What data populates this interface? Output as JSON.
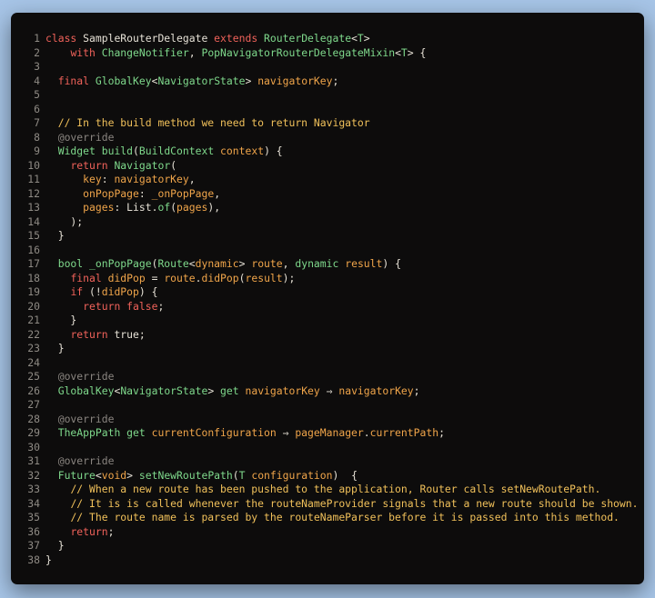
{
  "editor": {
    "lines": [
      {
        "n": "1",
        "tokens": [
          [
            "k",
            "class"
          ],
          [
            "n",
            " SampleRouterDelegate "
          ],
          [
            "k",
            "extends"
          ],
          [
            "n",
            " "
          ],
          [
            "t",
            "RouterDelegate"
          ],
          [
            "n",
            "<"
          ],
          [
            "t",
            "T"
          ],
          [
            "n",
            ">"
          ]
        ]
      },
      {
        "n": "2",
        "tokens": [
          [
            "n",
            "    "
          ],
          [
            "k",
            "with"
          ],
          [
            "n",
            " "
          ],
          [
            "t",
            "ChangeNotifier"
          ],
          [
            "n",
            ", "
          ],
          [
            "t",
            "PopNavigatorRouterDelegateMixin"
          ],
          [
            "n",
            "<"
          ],
          [
            "t",
            "T"
          ],
          [
            "n",
            "> {"
          ]
        ]
      },
      {
        "n": "3",
        "tokens": []
      },
      {
        "n": "4",
        "tokens": [
          [
            "n",
            "  "
          ],
          [
            "k",
            "final"
          ],
          [
            "n",
            " "
          ],
          [
            "t",
            "GlobalKey"
          ],
          [
            "n",
            "<"
          ],
          [
            "t",
            "NavigatorState"
          ],
          [
            "n",
            "> "
          ],
          [
            "o",
            "navigatorKey"
          ],
          [
            "n",
            ";"
          ]
        ]
      },
      {
        "n": "5",
        "tokens": []
      },
      {
        "n": "6",
        "tokens": []
      },
      {
        "n": "7",
        "tokens": [
          [
            "n",
            "  "
          ],
          [
            "c",
            "// In the build method we need to return Navigator"
          ]
        ]
      },
      {
        "n": "8",
        "tokens": [
          [
            "n",
            "  "
          ],
          [
            "d",
            "@override"
          ]
        ]
      },
      {
        "n": "9",
        "tokens": [
          [
            "n",
            "  "
          ],
          [
            "t",
            "Widget"
          ],
          [
            "n",
            " "
          ],
          [
            "t",
            "build"
          ],
          [
            "n",
            "("
          ],
          [
            "t",
            "BuildContext"
          ],
          [
            "n",
            " "
          ],
          [
            "o",
            "context"
          ],
          [
            "n",
            ") {"
          ]
        ]
      },
      {
        "n": "10",
        "tokens": [
          [
            "n",
            "    "
          ],
          [
            "k",
            "return"
          ],
          [
            "n",
            " "
          ],
          [
            "t",
            "Navigator"
          ],
          [
            "n",
            "("
          ]
        ]
      },
      {
        "n": "11",
        "tokens": [
          [
            "n",
            "      "
          ],
          [
            "o",
            "key"
          ],
          [
            "n",
            ": "
          ],
          [
            "o",
            "navigatorKey"
          ],
          [
            "n",
            ","
          ]
        ]
      },
      {
        "n": "12",
        "tokens": [
          [
            "n",
            "      "
          ],
          [
            "o",
            "onPopPage"
          ],
          [
            "n",
            ": "
          ],
          [
            "o",
            "_onPopPage"
          ],
          [
            "n",
            ","
          ]
        ]
      },
      {
        "n": "13",
        "tokens": [
          [
            "n",
            "      "
          ],
          [
            "o",
            "pages"
          ],
          [
            "n",
            ": "
          ],
          [
            "n",
            "List."
          ],
          [
            "t",
            "of"
          ],
          [
            "n",
            "("
          ],
          [
            "o",
            "pages"
          ],
          [
            "n",
            "),"
          ]
        ]
      },
      {
        "n": "14",
        "tokens": [
          [
            "n",
            "    );"
          ]
        ]
      },
      {
        "n": "15",
        "tokens": [
          [
            "n",
            "  }"
          ]
        ]
      },
      {
        "n": "16",
        "tokens": []
      },
      {
        "n": "17",
        "tokens": [
          [
            "n",
            "  "
          ],
          [
            "t",
            "bool"
          ],
          [
            "n",
            " "
          ],
          [
            "t",
            "_onPopPage"
          ],
          [
            "n",
            "("
          ],
          [
            "t",
            "Route"
          ],
          [
            "n",
            "<"
          ],
          [
            "o",
            "dynamic"
          ],
          [
            "n",
            "> "
          ],
          [
            "o",
            "route"
          ],
          [
            "n",
            ", "
          ],
          [
            "t",
            "dynamic"
          ],
          [
            "n",
            " "
          ],
          [
            "o",
            "result"
          ],
          [
            "n",
            ") {"
          ]
        ]
      },
      {
        "n": "18",
        "tokens": [
          [
            "n",
            "    "
          ],
          [
            "k",
            "final"
          ],
          [
            "n",
            " "
          ],
          [
            "o",
            "didPop"
          ],
          [
            "n",
            " = "
          ],
          [
            "o",
            "route"
          ],
          [
            "n",
            "."
          ],
          [
            "o",
            "didPop"
          ],
          [
            "n",
            "("
          ],
          [
            "o",
            "result"
          ],
          [
            "n",
            ");"
          ]
        ]
      },
      {
        "n": "19",
        "tokens": [
          [
            "n",
            "    "
          ],
          [
            "k",
            "if"
          ],
          [
            "n",
            " (!"
          ],
          [
            "o",
            "didPop"
          ],
          [
            "n",
            ") {"
          ]
        ]
      },
      {
        "n": "20",
        "tokens": [
          [
            "n",
            "      "
          ],
          [
            "k",
            "return"
          ],
          [
            "n",
            " "
          ],
          [
            "k",
            "false"
          ],
          [
            "n",
            ";"
          ]
        ]
      },
      {
        "n": "21",
        "tokens": [
          [
            "n",
            "    }"
          ]
        ]
      },
      {
        "n": "22",
        "tokens": [
          [
            "n",
            "    "
          ],
          [
            "k",
            "return"
          ],
          [
            "n",
            " "
          ],
          [
            "n",
            "true;"
          ]
        ]
      },
      {
        "n": "23",
        "tokens": [
          [
            "n",
            "  }"
          ]
        ]
      },
      {
        "n": "24",
        "tokens": []
      },
      {
        "n": "25",
        "tokens": [
          [
            "n",
            "  "
          ],
          [
            "d",
            "@override"
          ]
        ]
      },
      {
        "n": "26",
        "tokens": [
          [
            "n",
            "  "
          ],
          [
            "t",
            "GlobalKey"
          ],
          [
            "n",
            "<"
          ],
          [
            "t",
            "NavigatorState"
          ],
          [
            "n",
            "> "
          ],
          [
            "t",
            "get"
          ],
          [
            "n",
            " "
          ],
          [
            "o",
            "navigatorKey"
          ],
          [
            "n",
            " ⇒ "
          ],
          [
            "o",
            "navigatorKey"
          ],
          [
            "n",
            ";"
          ]
        ]
      },
      {
        "n": "27",
        "tokens": []
      },
      {
        "n": "28",
        "tokens": [
          [
            "n",
            "  "
          ],
          [
            "d",
            "@override"
          ]
        ]
      },
      {
        "n": "29",
        "tokens": [
          [
            "n",
            "  "
          ],
          [
            "t",
            "TheAppPath"
          ],
          [
            "n",
            " "
          ],
          [
            "t",
            "get"
          ],
          [
            "n",
            " "
          ],
          [
            "o",
            "currentConfiguration"
          ],
          [
            "n",
            " ⇒ "
          ],
          [
            "o",
            "pageManager"
          ],
          [
            "n",
            "."
          ],
          [
            "o",
            "currentPath"
          ],
          [
            "n",
            ";"
          ]
        ]
      },
      {
        "n": "30",
        "tokens": []
      },
      {
        "n": "31",
        "tokens": [
          [
            "n",
            "  "
          ],
          [
            "d",
            "@override"
          ]
        ]
      },
      {
        "n": "32",
        "tokens": [
          [
            "n",
            "  "
          ],
          [
            "t",
            "Future"
          ],
          [
            "n",
            "<"
          ],
          [
            "o",
            "void"
          ],
          [
            "n",
            "> "
          ],
          [
            "t",
            "setNewRoutePath"
          ],
          [
            "n",
            "("
          ],
          [
            "t",
            "T"
          ],
          [
            "n",
            " "
          ],
          [
            "o",
            "configuration"
          ],
          [
            "n",
            ")  {"
          ]
        ]
      },
      {
        "n": "33",
        "tokens": [
          [
            "n",
            "    "
          ],
          [
            "c",
            "// When a new route has been pushed to the application, Router calls setNewRoutePath."
          ]
        ]
      },
      {
        "n": "34",
        "tokens": [
          [
            "n",
            "    "
          ],
          [
            "c",
            "// It is is called whenever the routeNameProvider signals that a new route should be shown."
          ]
        ]
      },
      {
        "n": "35",
        "tokens": [
          [
            "n",
            "    "
          ],
          [
            "c",
            "// The route name is parsed by the routeNameParser before it is passed into this method."
          ]
        ]
      },
      {
        "n": "36",
        "tokens": [
          [
            "n",
            "    "
          ],
          [
            "k",
            "return"
          ],
          [
            "n",
            ";"
          ]
        ]
      },
      {
        "n": "37",
        "tokens": [
          [
            "n",
            "  }"
          ]
        ]
      },
      {
        "n": "38",
        "tokens": [
          [
            "n",
            "}"
          ]
        ]
      }
    ]
  }
}
